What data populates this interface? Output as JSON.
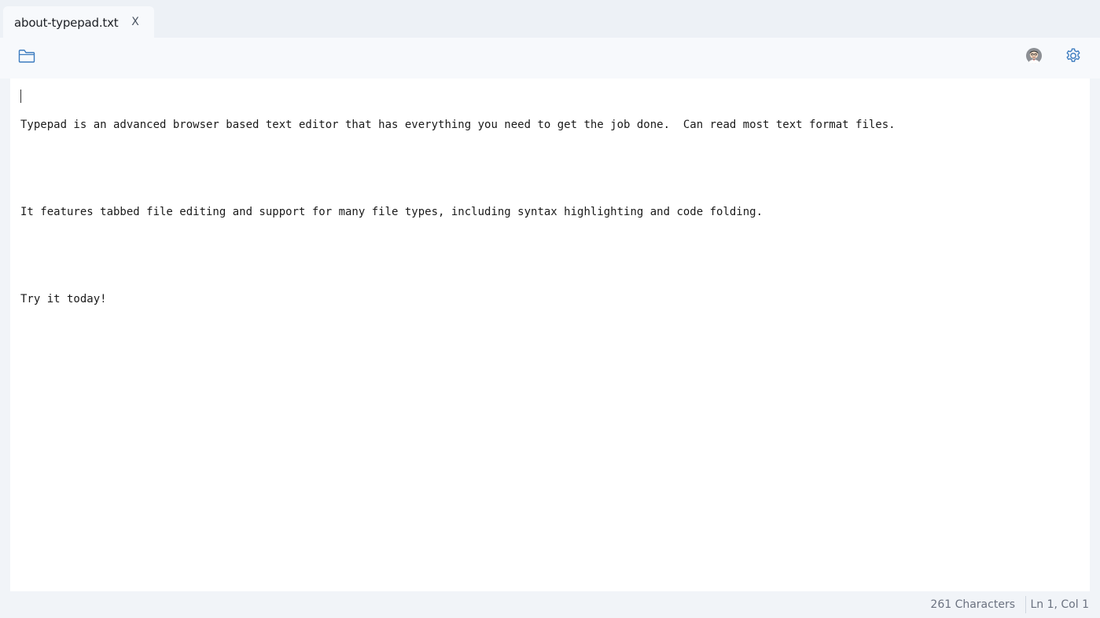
{
  "tabs": [
    {
      "label": "about-typepad.txt",
      "close_label": "X",
      "active": true
    }
  ],
  "toolbar": {
    "open_icon": "folder-icon",
    "avatar_icon": "user-avatar-icon",
    "settings_icon": "gear-icon"
  },
  "editor": {
    "lines": [
      "Typepad is an advanced browser based text editor that has everything you need to get the job done.  Can read most text format files.",
      "",
      "It features tabbed file editing and support for many file types, including syntax highlighting and code folding.",
      "",
      "Try it today!"
    ]
  },
  "status": {
    "characters": "261 Characters",
    "position": "Ln 1, Col 1"
  },
  "colors": {
    "accent": "#3b7bbf",
    "background": "#f1f4f8",
    "editor_bg": "#ffffff"
  }
}
